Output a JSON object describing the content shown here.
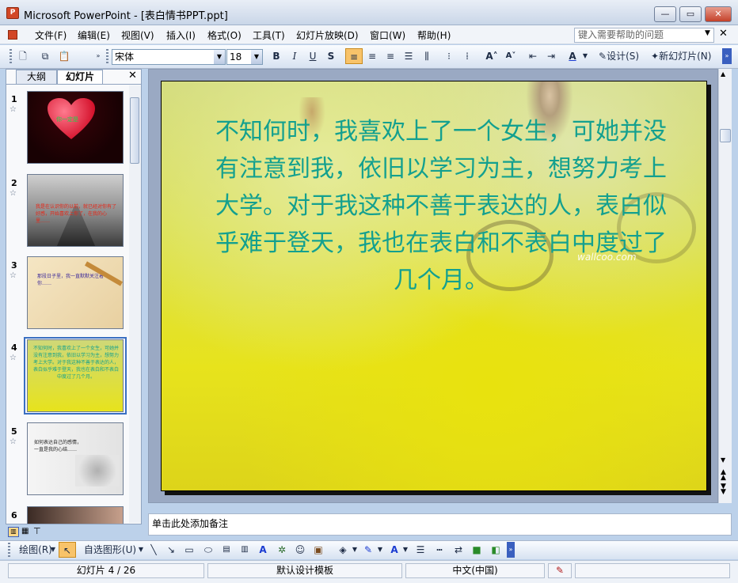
{
  "window": {
    "app_name": "Microsoft PowerPoint",
    "title": "Microsoft PowerPoint - [表白情书PPT.ppt]",
    "icon": "powerpoint-app-icon",
    "controls": [
      "minimize",
      "maximize",
      "close"
    ]
  },
  "menu": {
    "items": [
      "文件(F)",
      "编辑(E)",
      "视图(V)",
      "插入(I)",
      "格式(O)",
      "工具(T)",
      "幻灯片放映(D)",
      "窗口(W)",
      "帮助(H)"
    ],
    "help_placeholder": "键入需要帮助的问题"
  },
  "formatting": {
    "font_name": "宋体",
    "font_size": "18",
    "bold": "B",
    "italic": "I",
    "underline": "U",
    "shadow": "S",
    "design_label": "设计(S)",
    "new_slide_label": "新幻灯片(N)"
  },
  "left_pane": {
    "tabs": [
      "大纲",
      "幻灯片"
    ],
    "active_tab": "幻灯片",
    "selected_slide": 4,
    "slides": [
      {
        "num": "1",
        "star": "☆",
        "text": "你一定是"
      },
      {
        "num": "2",
        "star": "☆",
        "text": "我是在认识你的以前，就已经对你有了好感，开始喜欢上你了，在我的心里……"
      },
      {
        "num": "3",
        "star": "☆",
        "text": "那段日子里，我一直默默关注着你……"
      },
      {
        "num": "4",
        "star": "☆",
        "text": "不知何时，我喜欢上了一个女生，可她并没有注意到我，依旧以学习为主，想努力考上大学。对于我这种不善于表达的人，表白似乎难于登天，我也在表白和不表白中度过了几个月。"
      },
      {
        "num": "5",
        "star": "☆",
        "text": "如何表达自己的感情，一直是我的心结……"
      },
      {
        "num": "6",
        "star": "",
        "text": ""
      }
    ]
  },
  "slide": {
    "body_text": "不知何时，我喜欢上了一个女生，可她并没有注意到我，依旧以学习为主，想努力考上大学。对于我这种不善于表达的人，表白似乎难于登天，我也在表白和不表白中度过了几个月。",
    "watermark": "wallcoo.com"
  },
  "notes": {
    "placeholder": "单击此处添加备注"
  },
  "drawing_toolbar": {
    "draw_label": "绘图(R)",
    "autoshapes_label": "自选图形(U)"
  },
  "status": {
    "slide_indicator": "幻灯片 4 / 26",
    "template": "默认设计模板",
    "language": "中文(中国)"
  },
  "colors": {
    "slide_text": "#13a08f",
    "selection_border": "#3a6fc2"
  }
}
